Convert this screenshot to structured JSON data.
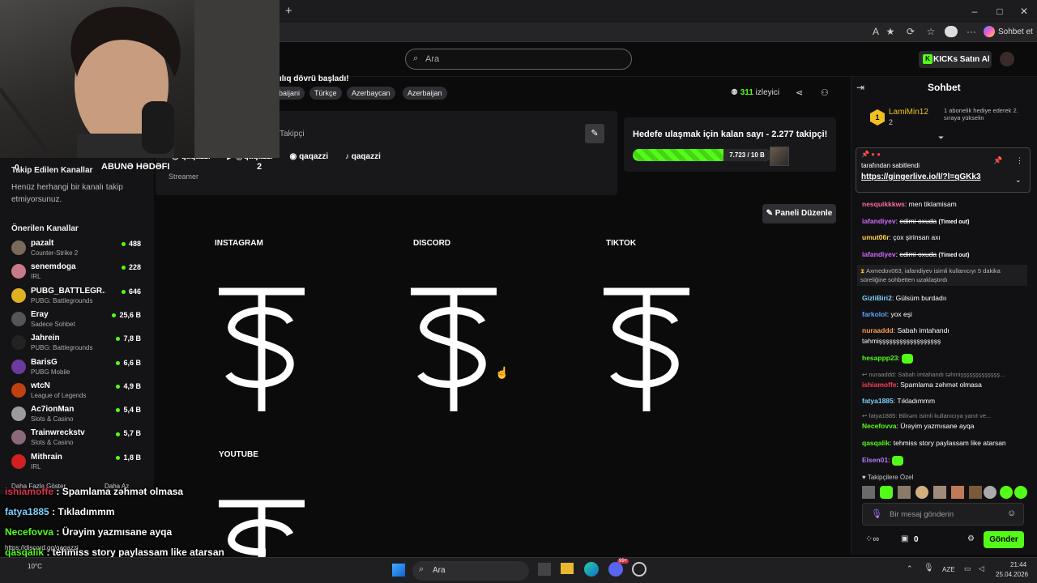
{
  "browser": {
    "new_tab": "+",
    "window": {
      "minimize": "–",
      "maximize": "□",
      "close": "✕"
    },
    "toolbar": {
      "reader": "A",
      "more": "···",
      "copilot_label": "Sohbet et"
    }
  },
  "kick_header": {
    "search_placeholder": "Ara",
    "kicks_button": "KICKs Satın Al",
    "kicks_icon": "K"
  },
  "stream": {
    "title_fragment": "ılıq dövrü başladı!",
    "tags": [
      "baijani",
      "Türkçe",
      "Azerbaycan",
      "Azerbaijan"
    ],
    "viewers_count": "311",
    "viewers_label": "izleyici"
  },
  "about": {
    "followers_label": "Takipçi",
    "socials": [
      "qaqazzi",
      "@qaqazzi",
      "qaqazzi",
      "qaqazzi"
    ],
    "role": "Streamer"
  },
  "goal": {
    "title": "Hedefe ulaşmak için kalan sayı - 2.277 takipçi!",
    "progress_text": "7.723 / 10 B",
    "progress_fraction": 0.7723
  },
  "edit_panel_button": "Paneli Düzenle",
  "panels": [
    "INSTAGRAM",
    "DISCORD",
    "TIKTOK",
    "YOUTUBE"
  ],
  "sidebar": {
    "stats": {
      "left": "0",
      "mid": "ABUNƏ HƏDƏFI",
      "right": "2"
    },
    "followed_title": "Takip Edilen Kanallar",
    "followed_empty": "Henüz herhangi bir kanalı takip etmiyorsunuz.",
    "recommended_title": "Önerilen Kanallar",
    "channels": [
      {
        "name": "pazalt",
        "category": "Counter-Strike 2",
        "viewers": "488",
        "color": "#7a6a5a"
      },
      {
        "name": "senemdoga",
        "category": "IRL",
        "viewers": "228",
        "color": "#c87a8a"
      },
      {
        "name": "PUBG_BATTLEGR...",
        "category": "PUBG: Battlegrounds",
        "viewers": "646",
        "color": "#e0b020"
      },
      {
        "name": "Eray",
        "category": "Sadece Sohbet",
        "viewers": "25,6 B",
        "color": "#555"
      },
      {
        "name": "Jahrein",
        "category": "PUBG: Battlegrounds",
        "viewers": "7,8 B",
        "color": "#222"
      },
      {
        "name": "BarisG",
        "category": "PUBG Mobile",
        "viewers": "6,6 B",
        "color": "#6a3aa0"
      },
      {
        "name": "wtcN",
        "category": "League of Legends",
        "viewers": "4,9 B",
        "color": "#c04010"
      },
      {
        "name": "Ac7ionMan",
        "category": "Slots & Casino",
        "viewers": "5,4 B",
        "color": "#9a9aa0"
      },
      {
        "name": "Trainwreckstv",
        "category": "Slots & Casino",
        "viewers": "5,7 B",
        "color": "#8a6a7a"
      },
      {
        "name": "Mithrain",
        "category": "IRL",
        "viewers": "1,8 B",
        "color": "#d02020"
      }
    ],
    "show_more": "Daha Fazla Göster",
    "show_less": "Daha Az"
  },
  "chat": {
    "header": "Sohbet",
    "top_gifter": {
      "name": "LamiMin12",
      "rank": "1",
      "count": "2",
      "note": "1 abonelik hediye ederek 2. sıraya yükselin"
    },
    "pinned": {
      "by_label": "tarafından sabitlendi",
      "link": "https://gingerlive.io/l/?l=qGKk3"
    },
    "messages": [
      {
        "user": "nesquikkkws",
        "color": "#ff6b9d",
        "text": "men tiklamisam"
      },
      {
        "user": "iafandiyev",
        "color": "#d36cff",
        "text": "edimi oxuda",
        "note": "(Timed out)"
      },
      {
        "user": "umut06r",
        "color": "#ffd24a",
        "text": "çox şirinsan axı"
      },
      {
        "user": "iafandiyev",
        "color": "#d36cff",
        "text": "edimi oxuda",
        "note": "(Timed out)"
      },
      {
        "system": "Axmedov063, iafandiyev isimli kullanıcıyı 5 dakika süreliğine sohbetten uzaklaştırdı"
      },
      {
        "user": "GizliBiri2",
        "color": "#7ad1ff",
        "text": "Gülsüm burdadıı"
      },
      {
        "user": "farkolol",
        "color": "#5ea6ff",
        "text": "yox eşi"
      },
      {
        "user": "nuraaddd",
        "color": "#ff9b4a",
        "text": "Sabah imtahandı təhmişşşşşşşşşşşşşşşşşş"
      },
      {
        "user": "hesappp23",
        "color": "#53fc18",
        "text": ""
      },
      {
        "reply": "nuraaddd: Sabah imtahandı təhmişşşşşşşşşşşşş...",
        "user": "ishiamoffe",
        "color": "#ff3b5c",
        "text": "Spamlama zəhmət olmasa"
      },
      {
        "user": "fatya1885",
        "color": "#7ad1ff",
        "text": "Tıkladımmm"
      },
      {
        "reply": "fatya1885: Bilirəm  isimli kullanıcıya yanıt ve...",
        "user": "Necefovva",
        "color": "#53fc18",
        "text": "Ürəyim yazmısane ayqa"
      },
      {
        "user": "qasqalik",
        "color": "#53fc18",
        "text": "tehmiss story paylassam like atarsan"
      },
      {
        "user": "Elsen01",
        "color": "#b57aff",
        "text": ""
      }
    ],
    "followers_only_label": "Takipçilere Özel",
    "input_placeholder": "Bir mesaj gönderin",
    "points": "0",
    "send_button": "Gönder"
  },
  "overlay_chat": [
    {
      "user": "ishiamoffe",
      "color": "#d6344a",
      "text": ": Spamlama zəhmət olmasa"
    },
    {
      "user": "fatya1885",
      "color": "#7ad1ff",
      "text": ": Tıkladımmm"
    },
    {
      "user": "Necefovva",
      "color": "#53fc18",
      "text": ": Ürəyim yazmısane ayqa"
    },
    {
      "user": "qasqalik",
      "color": "#53fc18",
      "text": ": tehmiss story paylassam like atarsan"
    },
    {
      "user": "Elsen01",
      "color": "#b57aff",
      "text": ":"
    }
  ],
  "overlay_url": "https://discord.gg/qaqazzi",
  "taskbar": {
    "weather": "10°C",
    "search": "Ara",
    "lang": "AZE",
    "time": "21:44",
    "date": "25.04.2026",
    "badge": "99+"
  },
  "colors": {
    "kick_green": "#53fc18",
    "chat_bg": "#111113",
    "card_bg": "#18181b"
  }
}
